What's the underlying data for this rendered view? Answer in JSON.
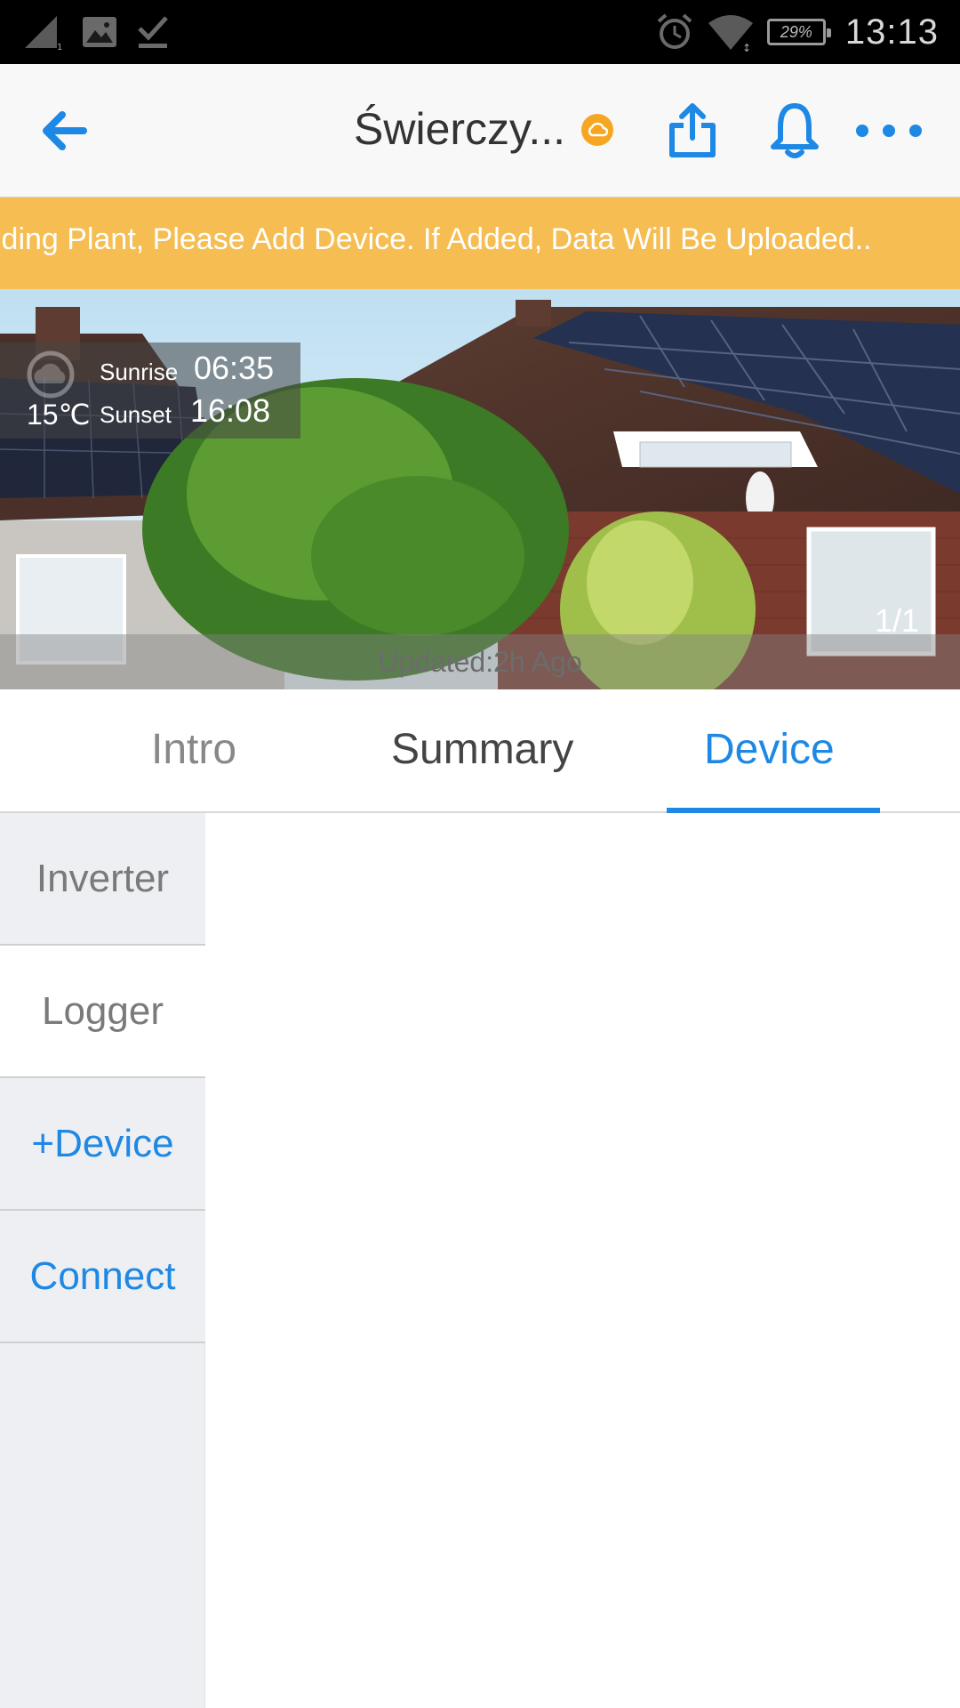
{
  "status_bar": {
    "time": "13:13",
    "battery": "29%"
  },
  "app_bar": {
    "title": "Świerczy..."
  },
  "notice": {
    "text": "lding Plant, Please Add Device. If Added, Data Will Be Uploaded.."
  },
  "hero": {
    "temperature": "15℃",
    "sunrise_label": "Sunrise",
    "sunrise_time": "06:35",
    "sunset_label": "Sunset",
    "sunset_time": "16:08",
    "page_indicator": "1/1",
    "updated": "Updated:2h Ago"
  },
  "tabs": [
    {
      "label": "Intro",
      "selected": false
    },
    {
      "label": "Summary",
      "selected": false
    },
    {
      "label": "Device",
      "selected": true
    }
  ],
  "sidebar": {
    "items": [
      {
        "label": "Inverter"
      },
      {
        "label": "Logger"
      },
      {
        "label": "+Device"
      },
      {
        "label": "Connect"
      }
    ]
  },
  "colors": {
    "accent": "#1e88e5",
    "banner": "#f5bd52",
    "cloud_badge": "#f5a623"
  }
}
